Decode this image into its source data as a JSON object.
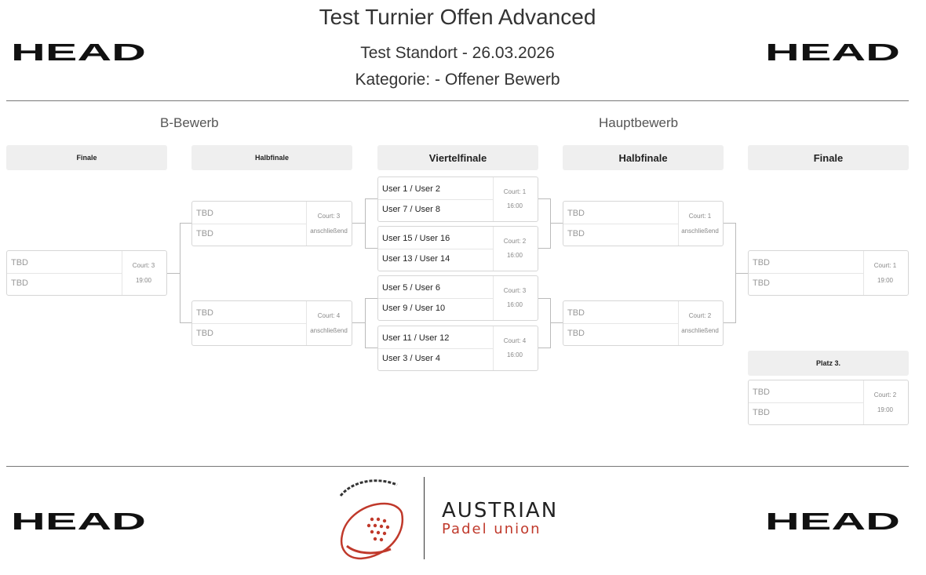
{
  "header": {
    "title": "Test Turnier Offen Advanced",
    "subtitle": "Test Standort - 26.03.2026",
    "category": "Kategorie: - Offener Bewerb"
  },
  "logos": {
    "head": "HEAD",
    "union_line1": "AUSTRIAN",
    "union_line2": "Padel union"
  },
  "sections": {
    "b_bewerb": "B-Bewerb",
    "hauptbewerb": "Hauptbewerb"
  },
  "columns": {
    "b_finale": "Finale",
    "b_halbfinale": "Halbfinale",
    "viertelfinale": "Viertelfinale",
    "h_halbfinale": "Halbfinale",
    "h_finale": "Finale",
    "platz3": "Platz 3."
  },
  "matches": {
    "b_final": {
      "p1": "TBD",
      "p2": "TBD",
      "court": "Court: 3",
      "time": "19:00"
    },
    "b_semi1": {
      "p1": "TBD",
      "p2": "TBD",
      "court": "Court: 3",
      "time": "anschließend"
    },
    "b_semi2": {
      "p1": "TBD",
      "p2": "TBD",
      "court": "Court: 4",
      "time": "anschließend"
    },
    "qf1": {
      "p1": "User 1 / User 2",
      "p2": "User 7 / User 8",
      "court": "Court: 1",
      "time": "16:00"
    },
    "qf2": {
      "p1": "User 15 / User 16",
      "p2": "User 13 / User 14",
      "court": "Court: 2",
      "time": "16:00"
    },
    "qf3": {
      "p1": "User 5 / User 6",
      "p2": "User 9 / User 10",
      "court": "Court: 3",
      "time": "16:00"
    },
    "qf4": {
      "p1": "User 11 / User 12",
      "p2": "User 3 / User 4",
      "court": "Court: 4",
      "time": "16:00"
    },
    "h_semi1": {
      "p1": "TBD",
      "p2": "TBD",
      "court": "Court: 1",
      "time": "anschließend"
    },
    "h_semi2": {
      "p1": "TBD",
      "p2": "TBD",
      "court": "Court: 2",
      "time": "anschließend"
    },
    "h_final": {
      "p1": "TBD",
      "p2": "TBD",
      "court": "Court: 1",
      "time": "19:00"
    },
    "platz3": {
      "p1": "TBD",
      "p2": "TBD",
      "court": "Court: 2",
      "time": "19:00"
    }
  },
  "colors": {
    "brand_red": "#c0392b",
    "text_dark": "#333333",
    "header_bg": "#efefef"
  }
}
